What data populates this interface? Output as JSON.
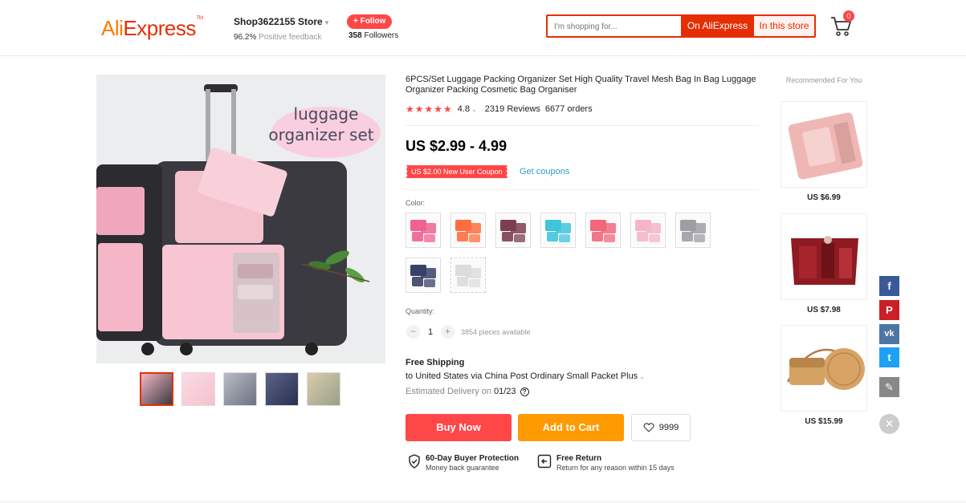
{
  "header": {
    "logo": {
      "part_a": "Ali",
      "part_b": "Express",
      "tm": "TM"
    },
    "store_name": "Shop3622155 Store",
    "feedback_value": "96.2%",
    "feedback_label": "Positive feedback",
    "follow_label": "+ Follow",
    "followers_count": "358",
    "followers_label": "Followers",
    "search_placeholder": "I'm shopping for...",
    "search_on_aliexpress": "On AliExpress",
    "search_in_store": "In this store",
    "cart_count": "0"
  },
  "product": {
    "title": "6PCS/Set Luggage Packing Organizer Set High Quality Travel Mesh Bag In Bag Luggage Organizer Packing Cosmetic Bag Organiser",
    "image_headline_1": "luggage",
    "image_headline_2": "organizer set",
    "rating_value": 4.8,
    "rating_text": "4.8",
    "reviews": "2319 Reviews",
    "orders": "6677 orders",
    "price": "US $2.99 - 4.99",
    "coupon": "US $2.00 New User Coupon",
    "get_coupons": "Get coupons",
    "color_label": "Color:",
    "colors": [
      "#f06292",
      "#ff6d3f",
      "#7b3f4f",
      "#40c4dc",
      "#f2677a",
      "#f4b6c6",
      "#9e9ea6",
      "#3a4166",
      "#dcdcdc"
    ],
    "quantity_label": "Quantity:",
    "quantity_minus": "−",
    "quantity_plus": "+",
    "quantity_value": "1",
    "quantity_available": "3854 pieces available",
    "shipping_title": "Free Shipping",
    "shipping_detail": "to United States via China Post Ordinary Small Packet Plus",
    "delivery_label": "Estimated Delivery on",
    "delivery_date": "01/23",
    "buy_now": "Buy Now",
    "add_to_cart": "Add to Cart",
    "wishlist_count": "9999",
    "guarantees": [
      {
        "title": "60-Day Buyer Protection",
        "sub": "Money back guarantee"
      },
      {
        "title": "Free Return",
        "sub": "Return for any reason within 15 days"
      }
    ],
    "thumbnails": [
      "#f4b6c6",
      "#f4c2cd",
      "#8b8f9c",
      "#3a4166",
      "#c8b89a"
    ]
  },
  "recommended": {
    "title": "Recommended For You",
    "items": [
      {
        "price": "US $6.99"
      },
      {
        "price": "US $7.98"
      },
      {
        "price": "US $15.99"
      }
    ]
  },
  "social": [
    {
      "icon": "facebook-icon",
      "glyph": "f",
      "color": "#3b5998"
    },
    {
      "icon": "pinterest-icon",
      "glyph": "P",
      "color": "#cb2027"
    },
    {
      "icon": "vk-icon",
      "glyph": "vk",
      "color": "#4c75a3"
    },
    {
      "icon": "twitter-icon",
      "glyph": "t",
      "color": "#1da1f2"
    },
    {
      "icon": "edit-icon",
      "glyph": "✎",
      "color": "#888888"
    }
  ]
}
